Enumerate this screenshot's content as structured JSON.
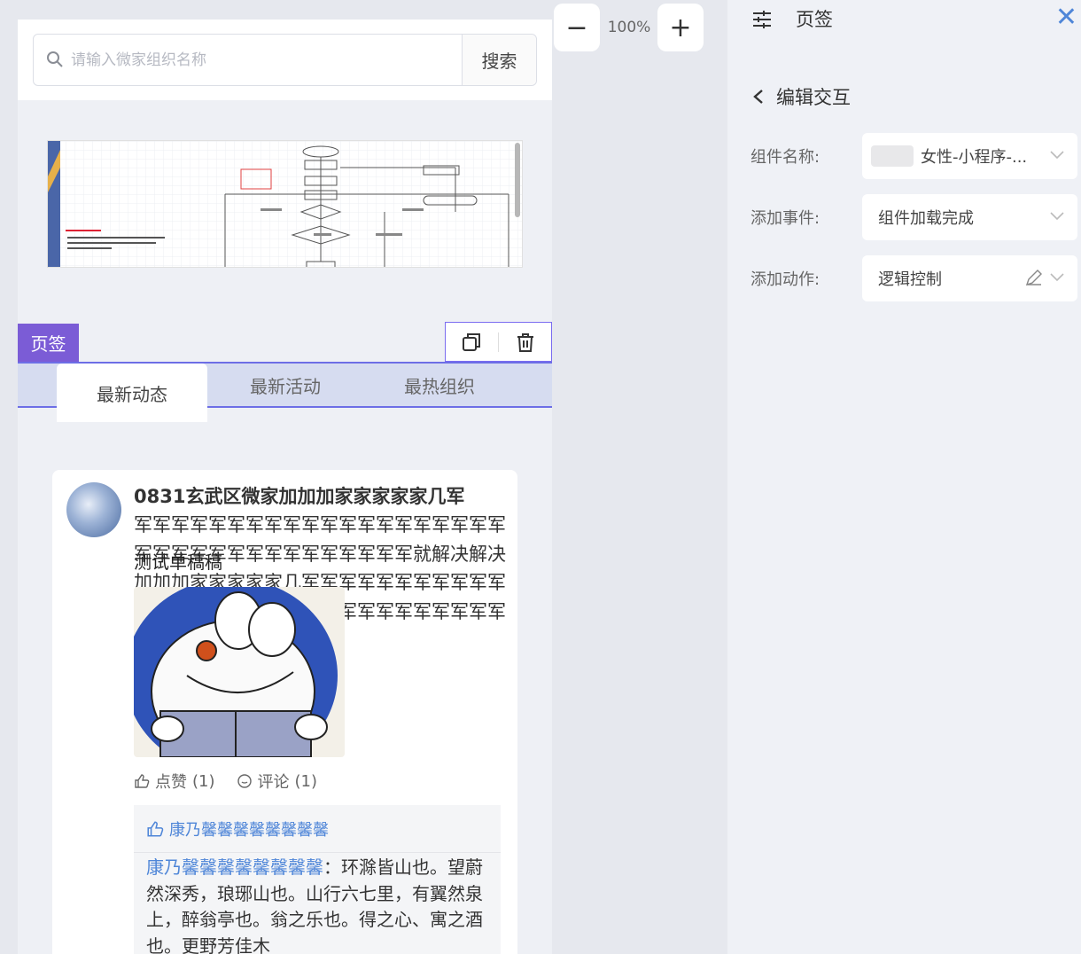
{
  "search": {
    "placeholder": "请输入微家组织名称",
    "button_label": "搜索"
  },
  "tag_component": {
    "label": "页签"
  },
  "tabs": [
    {
      "label": "最新动态",
      "active": true
    },
    {
      "label": "最新活动",
      "active": false
    },
    {
      "label": "最热组织",
      "active": false
    }
  ],
  "post": {
    "title": "0831玄武区微家加加加家家家家家几军",
    "body": "军军军军军军军军军军军军军军军军军军军军军军军军军军军军军军军军军军军就解决解决加加加家家家家家几军军军军军军军军军军军军军军军军军军军军军军军军军军军军军军军",
    "overlay_text": "测试单稿稿",
    "image_icon": "doraemon-reading-image",
    "like_label": "点赞",
    "like_count": "(1)",
    "comment_label": "评论",
    "comment_count": "(1)",
    "liked_by": "康乃馨馨馨馨馨馨馨馨",
    "comment_author": "康乃馨馨馨馨馨馨馨馨",
    "comment_text": "：环滁皆山也。望蔚然深秀，琅琊山也。山行六七里，有翼然泉上，醉翁亭也。翁之乐也。得之心、寓之酒也。更野芳佳木"
  },
  "zoom": {
    "value": "100%",
    "minus": "−",
    "plus": "+"
  },
  "panel": {
    "title": "页签",
    "close": "✕",
    "back_label": "编辑交互",
    "fields": [
      {
        "label": "组件名称:",
        "value": "女性-小程序-..."
      },
      {
        "label": "添加事件:",
        "value": "组件加载完成"
      },
      {
        "label": "添加动作:",
        "value": "逻辑控制"
      }
    ]
  },
  "colors": {
    "accent": "#7b5cd6",
    "link": "#4f86d8",
    "tab_border": "#6d6ee6"
  }
}
